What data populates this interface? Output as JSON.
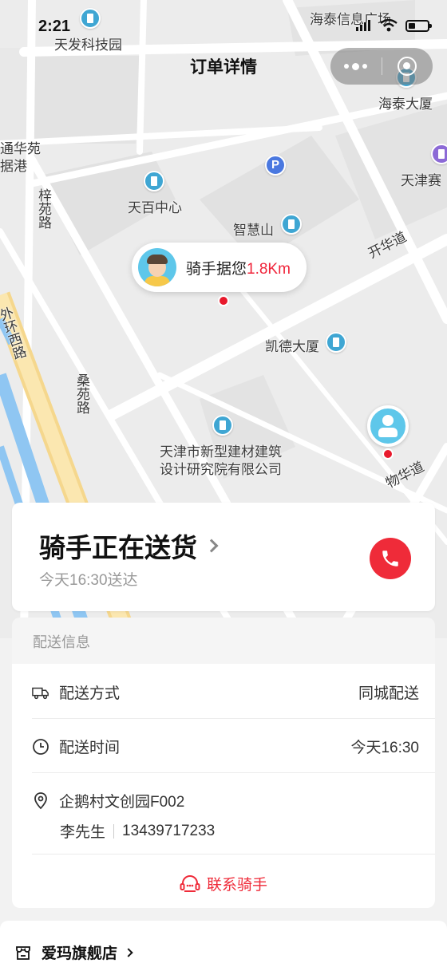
{
  "status_bar": {
    "time": "2:21"
  },
  "page_title": "订单详情",
  "map": {
    "labels": {
      "tianfa": "天发科技园",
      "haitai_info": "海泰信息广场",
      "haitai_tower": "海泰大厦",
      "tonghua": "通华苑",
      "data_port": "据港",
      "tianjin_sai": "天津赛",
      "tianbai": "天百中心",
      "zhihuishan": "智慧山",
      "ziyuan_road": "梓苑路",
      "kaihua_road": "开华道",
      "outer_ring": "外环西路",
      "kaide": "凯德大厦",
      "sangyuan_road": "桑苑路",
      "institute_1": "天津市新型建材建筑",
      "institute_2": "设计研究院有限公司",
      "wuhua_road": "物华道",
      "parking": "P"
    },
    "rider_bubble": {
      "prefix": "骑手据您",
      "distance": "1.8Km"
    }
  },
  "status_card": {
    "title": "骑手正在送货",
    "subtitle": "今天16:30送达"
  },
  "delivery_info": {
    "section_title": "配送信息",
    "method_label": "配送方式",
    "method_value": "同城配送",
    "time_label": "配送时间",
    "time_value": "今天16:30",
    "address": "企鹅村文创园F002",
    "contact_name": "李先生",
    "contact_phone": "13439717233",
    "contact_rider": "联系骑手"
  },
  "store": {
    "name": "爱玛旗舰店"
  },
  "colors": {
    "accent": "#ef2b39",
    "distance": "#f0243a",
    "poi": "#3fa6d3"
  }
}
